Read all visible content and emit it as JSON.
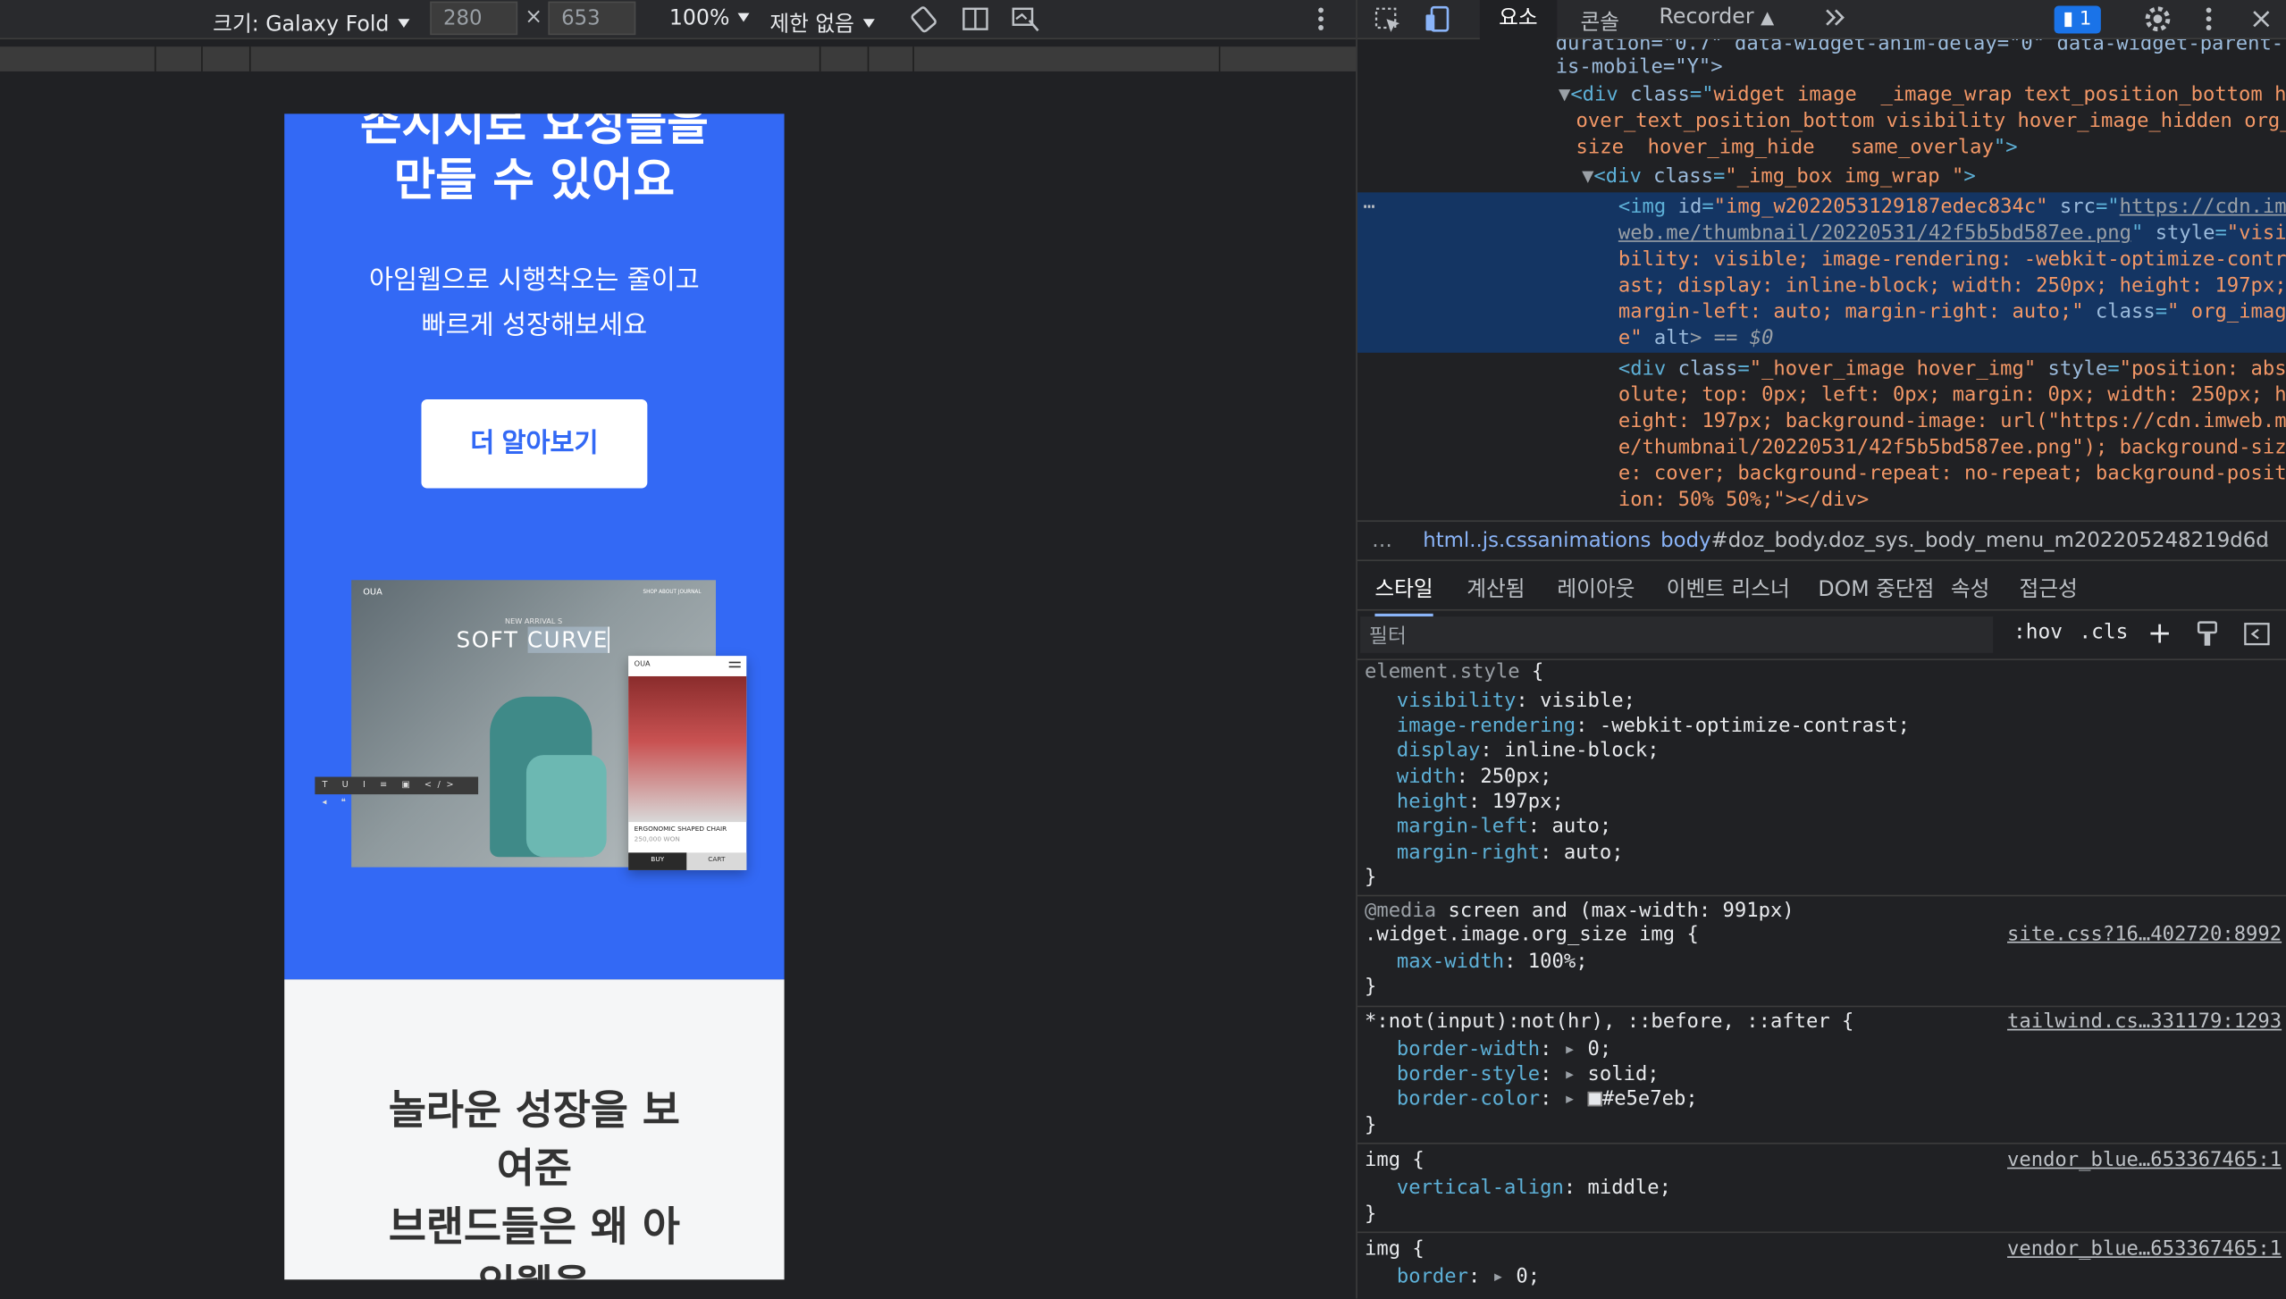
{
  "device_toolbar": {
    "size_label": "크기: Galaxy Fold",
    "width": "280",
    "times": "×",
    "height": "653",
    "zoom": "100%",
    "throttle": "제한 없음"
  },
  "page": {
    "hero_title_1": "손시지로 요성들을",
    "hero_title_2": "만들 수 있어요",
    "hero_sub_1": "아임웹으로 시행착오는 줄이고",
    "hero_sub_2": "빠르게 성장해보세요",
    "cta_label": "더 알아보기",
    "mock": {
      "brand": "OUA",
      "nav": "SHOP   ABOUT   JOURNAL",
      "arrival": "NEW ARRIVAL S",
      "headline_1": "SOFT ",
      "headline_2": "CURVE",
      "toolbar": "T U I ≡ ▣ </> ◂ ❝",
      "phone_brand": "OUA",
      "product": "ERGONOMIC SHAPED CHAIR",
      "price": "250,000 WON",
      "buy": "BUY",
      "cart": "CART"
    },
    "growth_1": "놀라운 성장을 보",
    "growth_2": "여준",
    "growth_3": "브랜드들은 왜 아",
    "growth_4": "임웹을"
  },
  "devtools": {
    "tabs": {
      "elements": "요소",
      "console": "콘솔",
      "recorder": "Recorder",
      "issues": "1"
    },
    "code": {
      "l0": "duration=\"0.7\" data-widget-anim-delay=\"0\" data-widget-parent-",
      "l1": "is-mobile=\"Y\">",
      "l2a": "<div ",
      "l2b": "class",
      "l2c": "=\"",
      "l2d": "widget image  _image_wrap text_position_bottom h",
      "l3": "over_text_position_bottom visibility hover_image_hidden org_",
      "l4": "size  hover_img_hide   same_overlay",
      "l5a": "<div ",
      "l5b": "class",
      "l5c": "\"_img_box img_wrap \"",
      "l6a": "<img ",
      "l6b": "id",
      "l6c": "\"img_w2022053129187edec834c\"",
      "l6d": "src",
      "l6e": "https://cdn.im",
      "l7a": "web.me/thumbnail/20220531/42f5b5bd587ee.png",
      "l7b": "style",
      "l7c": "\"visi",
      "l8": "bility: visible; image-rendering: -webkit-optimize-contr",
      "l9": "ast; display: inline-block; width: 250px; height: 197px;",
      "l10": "margin-left: auto; margin-right: auto;\"",
      "l10b": "class",
      "l10c": "\" org_imag",
      "l11a": "e\"",
      "l11b": " alt",
      "l11c": "> == $0",
      "l12a": "<div ",
      "l12b": "class",
      "l12c": "\"_hover_image hover_img\"",
      "l12d": "style",
      "l12e": "\"position: abs",
      "l13": "olute; top: 0px; left: 0px; margin: 0px; width: 250px; h",
      "l14": "eight: 197px; background-image: url(\"https://cdn.imweb.m",
      "l15": "e/thumbnail/20220531/42f5b5bd587ee.png\"); background-siz",
      "l16": "e: cover; background-repeat: no-repeat; background-posit",
      "l17": "ion: 50% 50%;\"></div>"
    },
    "breadcrumb": {
      "b1": "html..js.cssanimations",
      "b2": "body",
      "b3": "#doz_body.doz_sys._body_menu_m202205248219d6d"
    },
    "panel_tabs": {
      "styles": "스타일",
      "computed": "계산됨",
      "layout": "레이아웃",
      "listeners": "이벤트 리스너",
      "dom_bp": "DOM 중단점",
      "props": "속성",
      "a11y": "접근성"
    },
    "filter": {
      "placeholder": "필터",
      "hov": ":hov",
      "cls": ".cls"
    },
    "styles": {
      "r1_sel": "element.style {",
      "r1_p1": "visibility",
      "r1_v1": "visible;",
      "r1_p2": "image-rendering",
      "r1_v2": "-webkit-optimize-contrast;",
      "r1_p3": "display",
      "r1_v3": "inline-block;",
      "r1_p4": "width",
      "r1_v4": "250px;",
      "r1_p5": "height",
      "r1_v5": "197px;",
      "r1_p6": "margin-left",
      "r1_v6": "auto;",
      "r1_p7": "margin-right",
      "r1_v7": "auto;",
      "close": "}",
      "r2_media": "@media",
      "r2_mq": "screen and (max-width: 991px)",
      "r2_sel": ".widget.image.org_size img {",
      "r2_src": "site.css?16…402720:8992",
      "r2_p1": "max-width",
      "r2_v1": "100%;",
      "r3_sel": "*:not(input):not(hr), ::before, ::after {",
      "r3_src": "tailwind.cs…331179:1293",
      "r3_p1": "border-width",
      "r3_v1": "0;",
      "r3_p2": "border-style",
      "r3_v2": "solid;",
      "r3_p3": "border-color",
      "r3_v3": "#e5e7eb;",
      "r4_sel": "img {",
      "r4_src": "vendor_blue…653367465:1",
      "r4_p1": "vertical-align",
      "r4_v1": "middle;",
      "r5_sel": "img {",
      "r5_src": "vendor_blue…653367465:1",
      "r5_p1": "border",
      "r5_v1": "0;"
    }
  },
  "colors": {
    "brand_blue": "#3369f5",
    "selection": "#143563",
    "tag": "#5db0d7",
    "attr_value": "#f29766"
  }
}
